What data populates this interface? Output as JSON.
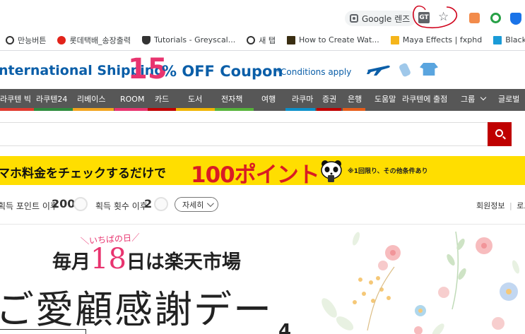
{
  "browser": {
    "lens_label": "Google 렌즈",
    "translate_glyph": "GT",
    "star_glyph": "☆"
  },
  "bookmarks": [
    {
      "icon": "globe-icon",
      "label": "만능버튼"
    },
    {
      "icon": "lotte-icon",
      "label": "롯데택배_송장출력"
    },
    {
      "icon": "shield-icon",
      "label": "Tutorials - Greyscal..."
    },
    {
      "icon": "globe-icon",
      "label": "새 탭"
    },
    {
      "icon": "r-logo-icon",
      "label": "How to Create Wat..."
    },
    {
      "icon": "fx-icon",
      "label": "Maya Effects | fxphd"
    },
    {
      "icon": "v-logo-icon",
      "label": "BlackGinger - Fi"
    }
  ],
  "promo": {
    "title": "nternational Shipping",
    "percent": "15",
    "offer": "% OFF Coupon",
    "conditions": "*Conditions apply"
  },
  "nav": {
    "items": [
      {
        "label": "라쿠텐 빅",
        "color": "#e03a2f"
      },
      {
        "label": "라쿠텐24",
        "color": "#2e8b3d"
      },
      {
        "label": "리베이스",
        "color": "#f2a41e"
      },
      {
        "label": "ROOM",
        "color": "#e8346f"
      },
      {
        "label": "카드",
        "color": "#bf0000"
      },
      {
        "label": "도서",
        "color": "#f0b400"
      },
      {
        "label": "전자책",
        "color": "#56b33a"
      },
      {
        "label": "여행",
        "color": "#575757"
      },
      {
        "label": "라쿠마",
        "color": "#0d90c9"
      },
      {
        "label": "증권",
        "color": "#bf0000"
      },
      {
        "label": "은행",
        "color": "#e65d1a"
      },
      {
        "label": "도움말",
        "color": "#575757"
      },
      {
        "label": "라쿠텐에 출점",
        "color": "#575757"
      },
      {
        "label": "그룹",
        "color": "#575757"
      },
      {
        "label": "글로벌",
        "color": "#575757"
      }
    ]
  },
  "search": {
    "value": "",
    "placeholder": ""
  },
  "banner": {
    "text": "マホ料金をチェックするだけで",
    "points": "100ポイント",
    "note": "※1回限り、その他条件あり"
  },
  "points": {
    "earn_label": "획득 포인트 이후",
    "earn_value": "200",
    "count_label": "획득 횟수 이후",
    "count_value": "2",
    "detail_label": "자세히",
    "member_label": "회원정보",
    "logout_label": "로그"
  },
  "hero": {
    "subtitle": "＼いちばの日／",
    "line1_pre": "毎月",
    "line1_num": "18",
    "line1_post": "日は楽天市場",
    "line2": "ご愛顧感謝デー",
    "partial_num": "4"
  }
}
